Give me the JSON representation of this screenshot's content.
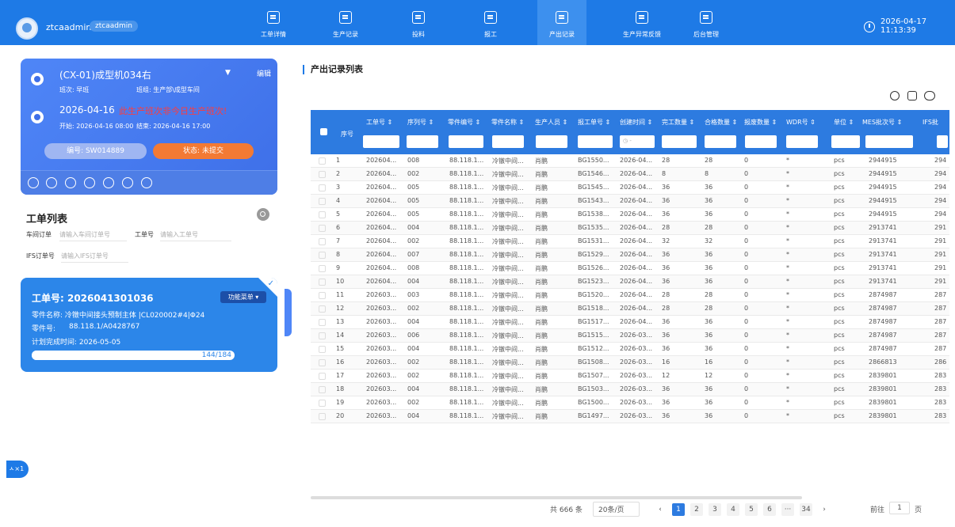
{
  "header": {
    "username": "ztcaadmin",
    "user_badge": "ztcaadmin",
    "nav": [
      {
        "label": "工单详情",
        "icon": "list-icon"
      },
      {
        "label": "生产记录",
        "icon": "calendar-icon"
      },
      {
        "label": "投料",
        "icon": "feed-icon"
      },
      {
        "label": "报工",
        "icon": "report-icon"
      },
      {
        "label": "产出记录",
        "icon": "output-icon",
        "active": true
      },
      {
        "label": "生产异常反馈",
        "icon": "alarm-icon"
      },
      {
        "label": "后台管理",
        "icon": "admin-icon"
      }
    ],
    "date": "2026-04-17",
    "time": "11:13:39",
    "accent": "#1e7ae6"
  },
  "machine": {
    "name": "(CX-01)成型机034右",
    "edit": "编辑",
    "shift_label": "班次: 早班",
    "group_label": "班组: 生产部\\成型车间",
    "date": "2026-04-16",
    "warning": "此生产班次非今日生产班次!",
    "start": "开始: 2026-04-16 08:00",
    "end": "结束: 2026-04-16 17:00",
    "code_btn": "编号: SW014889",
    "state_btn": "状态: 未提交"
  },
  "work_orders": {
    "title": "工单列表",
    "filters": {
      "workshop_label": "车间订单",
      "workshop_placeholder": "请输入车间订单号",
      "wo_label": "工单号",
      "wo_placeholder": "请输入工单号",
      "ifs_label": "IFS订单号",
      "ifs_placeholder": "请输入IFS订单号"
    },
    "card": {
      "wo_no": "工单号: 2026041301036",
      "menu": "功能菜单",
      "part_name": "零件名称: 冷镦中间接头预制主体 |CL020002#4|Φ24",
      "part_no_label": "零件号:",
      "part_no": "88.118.1/A0428767",
      "plan": "计划完成时间: 2026-05-05",
      "progress_text": "144/184",
      "progress": 0.7826
    }
  },
  "fab_label": "ㅅ×1",
  "table": {
    "title": "产出记录列表",
    "headers": [
      "序号",
      "工单号",
      "序列号",
      "零件编号",
      "零件名称",
      "生产人员",
      "报工单号",
      "创建时间",
      "完工数量",
      "合格数量",
      "报废数量",
      "WDR号",
      "单位",
      "MES批次号",
      "IFS批"
    ],
    "date_placeholder": "◷ -",
    "rows": [
      [
        "1",
        "202604...",
        "008",
        "88.118.1...",
        "冷镦中间...",
        "肖鹏",
        "BG1550...",
        "2026-04...",
        "28",
        "28",
        "0",
        "*",
        "pcs",
        "2944915",
        "294"
      ],
      [
        "2",
        "202604...",
        "002",
        "88.118.1...",
        "冷镦中间...",
        "肖鹏",
        "BG1546...",
        "2026-04...",
        "8",
        "8",
        "0",
        "*",
        "pcs",
        "2944915",
        "294"
      ],
      [
        "3",
        "202604...",
        "005",
        "88.118.1...",
        "冷镦中间...",
        "肖鹏",
        "BG1545...",
        "2026-04...",
        "36",
        "36",
        "0",
        "*",
        "pcs",
        "2944915",
        "294"
      ],
      [
        "4",
        "202604...",
        "005",
        "88.118.1...",
        "冷镦中间...",
        "肖鹏",
        "BG1543...",
        "2026-04...",
        "36",
        "36",
        "0",
        "*",
        "pcs",
        "2944915",
        "294"
      ],
      [
        "5",
        "202604...",
        "005",
        "88.118.1...",
        "冷镦中间...",
        "肖鹏",
        "BG1538...",
        "2026-04...",
        "36",
        "36",
        "0",
        "*",
        "pcs",
        "2944915",
        "294"
      ],
      [
        "6",
        "202604...",
        "004",
        "88.118.1...",
        "冷镦中间...",
        "肖鹏",
        "BG1535...",
        "2026-04...",
        "28",
        "28",
        "0",
        "*",
        "pcs",
        "2913741",
        "291"
      ],
      [
        "7",
        "202604...",
        "002",
        "88.118.1...",
        "冷镦中间...",
        "肖鹏",
        "BG1531...",
        "2026-04...",
        "32",
        "32",
        "0",
        "*",
        "pcs",
        "2913741",
        "291"
      ],
      [
        "8",
        "202604...",
        "007",
        "88.118.1...",
        "冷镦中间...",
        "肖鹏",
        "BG1529...",
        "2026-04...",
        "36",
        "36",
        "0",
        "*",
        "pcs",
        "2913741",
        "291"
      ],
      [
        "9",
        "202604...",
        "008",
        "88.118.1...",
        "冷镦中间...",
        "肖鹏",
        "BG1526...",
        "2026-04...",
        "36",
        "36",
        "0",
        "*",
        "pcs",
        "2913741",
        "291"
      ],
      [
        "10",
        "202604...",
        "004",
        "88.118.1...",
        "冷镦中间...",
        "肖鹏",
        "BG1523...",
        "2026-04...",
        "36",
        "36",
        "0",
        "*",
        "pcs",
        "2913741",
        "291"
      ],
      [
        "11",
        "202603...",
        "003",
        "88.118.1...",
        "冷镦中间...",
        "肖鹏",
        "BG1520...",
        "2026-04...",
        "28",
        "28",
        "0",
        "*",
        "pcs",
        "2874987",
        "287"
      ],
      [
        "12",
        "202603...",
        "002",
        "88.118.1...",
        "冷镦中间...",
        "肖鹏",
        "BG1518...",
        "2026-04...",
        "28",
        "28",
        "0",
        "*",
        "pcs",
        "2874987",
        "287"
      ],
      [
        "13",
        "202603...",
        "004",
        "88.118.1...",
        "冷镦中间...",
        "肖鹏",
        "BG1517...",
        "2026-04...",
        "36",
        "36",
        "0",
        "*",
        "pcs",
        "2874987",
        "287"
      ],
      [
        "14",
        "202603...",
        "006",
        "88.118.1...",
        "冷镦中间...",
        "肖鹏",
        "BG1515...",
        "2026-03...",
        "36",
        "36",
        "0",
        "*",
        "pcs",
        "2874987",
        "287"
      ],
      [
        "15",
        "202603...",
        "004",
        "88.118.1...",
        "冷镦中间...",
        "肖鹏",
        "BG1512...",
        "2026-03...",
        "36",
        "36",
        "0",
        "*",
        "pcs",
        "2874987",
        "287"
      ],
      [
        "16",
        "202603...",
        "002",
        "88.118.1...",
        "冷镦中间...",
        "肖鹏",
        "BG1508...",
        "2026-03...",
        "16",
        "16",
        "0",
        "*",
        "pcs",
        "2866813",
        "286"
      ],
      [
        "17",
        "202603...",
        "002",
        "88.118.1...",
        "冷镦中间...",
        "肖鹏",
        "BG1507...",
        "2026-03...",
        "12",
        "12",
        "0",
        "*",
        "pcs",
        "2839801",
        "283"
      ],
      [
        "18",
        "202603...",
        "004",
        "88.118.1...",
        "冷镦中间...",
        "肖鹏",
        "BG1503...",
        "2026-03...",
        "36",
        "36",
        "0",
        "*",
        "pcs",
        "2839801",
        "283"
      ],
      [
        "19",
        "202603...",
        "002",
        "88.118.1...",
        "冷镦中间...",
        "肖鹏",
        "BG1500...",
        "2026-03...",
        "36",
        "36",
        "0",
        "*",
        "pcs",
        "2839801",
        "283"
      ],
      [
        "20",
        "202603...",
        "004",
        "88.118.1...",
        "冷镦中间...",
        "肖鹏",
        "BG1497...",
        "2026-03...",
        "36",
        "36",
        "0",
        "*",
        "pcs",
        "2839801",
        "283"
      ]
    ]
  },
  "pagination": {
    "total": "共 666 条",
    "page_size": "20条/页",
    "pages": [
      "1",
      "2",
      "3",
      "4",
      "5",
      "6",
      "···",
      "34"
    ],
    "current": "1",
    "goto_label": "前往",
    "goto_value": "1",
    "page_unit": "页"
  }
}
